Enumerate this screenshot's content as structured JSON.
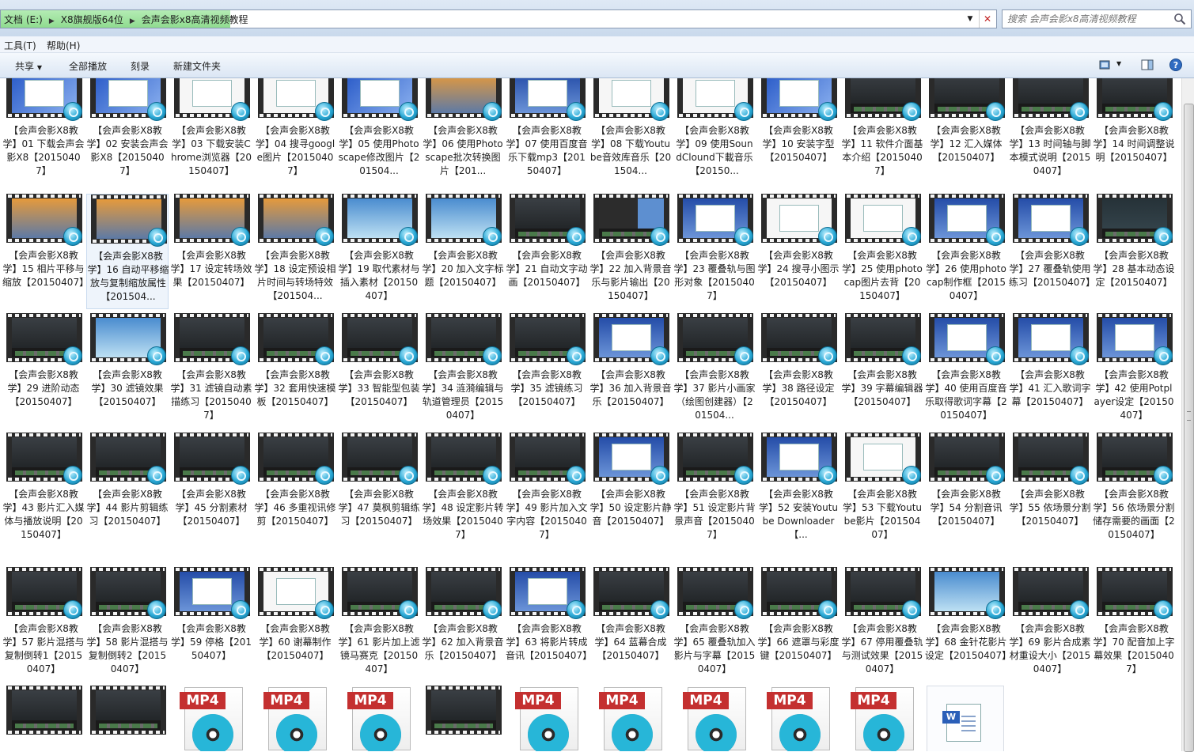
{
  "address": {
    "crumbs": [
      "文档 (E:)",
      "X8旗舰版64位",
      "会声会影x8高清视频教程"
    ],
    "search_placeholder": "搜索 会声会影x8高清视频教程"
  },
  "menu": {
    "tools": "工具(T)",
    "help": "帮助(H)"
  },
  "toolbar": {
    "share": "共享",
    "play_all": "全部播放",
    "burn": "刻录",
    "new_folder": "新建文件夹"
  },
  "items": [
    {
      "name": "【会声会影X8教学】01 下载会声会影X8【20150407】",
      "thumb": "s-blue"
    },
    {
      "name": "【会声会影X8教学】02 安装会声会影X8【20150407】",
      "thumb": "s-blue"
    },
    {
      "name": "【会声会影X8教学】03 下载安装Chrome浏览器【20150407】",
      "thumb": "s-white"
    },
    {
      "name": "【会声会影X8教学】04 搜寻google图片【20150407】",
      "thumb": "s-white"
    },
    {
      "name": "【会声会影X8教学】05 使用Photoscape修改图片【201504...",
      "thumb": "s-blue"
    },
    {
      "name": "【会声会影X8教学】06 使用Photoscape批次转换图片【201...",
      "thumb": "s-sunset"
    },
    {
      "name": "【会声会影X8教学】07 使用百度音乐下载mp3【20150407】",
      "thumb": "s-win"
    },
    {
      "name": "【会声会影X8教学】08 下载Youtube音效库音乐【201504...",
      "thumb": "s-white"
    },
    {
      "name": "【会声会影X8教学】09 使用SoundClound下載音乐【20150...",
      "thumb": "s-white"
    },
    {
      "name": "【会声会影X8教学】10 安装字型【20150407】",
      "thumb": "s-blue"
    },
    {
      "name": "【会声会影X8教学】11 软件介面基本介绍【20150407】",
      "thumb": "s-dark"
    },
    {
      "name": "【会声会影X8教学】12 汇入媒体【20150407】",
      "thumb": "s-dark"
    },
    {
      "name": "【会声会影X8教学】13 时间轴与脚本模式说明【20150407】",
      "thumb": "s-dark"
    },
    {
      "name": "【会声会影X8教学】14 时间调整说明【20150407】",
      "thumb": "s-dark"
    },
    {
      "name": "【会声会影X8教学】15 相片平移与缩放【20150407】",
      "thumb": "s-sunset"
    },
    {
      "name": "【会声会影X8教学】16 自动平移缩放与复制缩放属性【201504...",
      "thumb": "s-sunset"
    },
    {
      "name": "【会声会影X8教学】17 设定转场效果【20150407】",
      "thumb": "s-sunset"
    },
    {
      "name": "【会声会影X8教学】18 设定预设相片时间与转场特效【201504...",
      "thumb": "s-sunset"
    },
    {
      "name": "【会声会影X8教学】19 取代素材与插入素材【20150407】",
      "thumb": "s-sky"
    },
    {
      "name": "【会声会影X8教学】20 加入文字标题【20150407】",
      "thumb": "s-sky"
    },
    {
      "name": "【会声会影X8教学】21 自动文字动画【20150407】",
      "thumb": "s-dark"
    },
    {
      "name": "【会声会影X8教学】22 加入背景音乐与影片输出【20150407】",
      "thumb": "s-mixed"
    },
    {
      "name": "【会声会影X8教学】23 覆叠轨与图形对象【20150407】",
      "thumb": "s-win"
    },
    {
      "name": "【会声会影X8教学】24 搜寻小图示【20150407】",
      "thumb": "s-white"
    },
    {
      "name": "【会声会影X8教学】25 使用photocap图片去背【20150407】",
      "thumb": "s-white"
    },
    {
      "name": "【会声会影X8教学】26 使用photocap制作框【20150407】",
      "thumb": "s-win"
    },
    {
      "name": "【会声会影X8教学】27 覆叠轨使用练习【20150407】",
      "thumb": "s-win"
    },
    {
      "name": "【会声会影X8教学】28 基本动态设定【20150407】",
      "thumb": "s-teal"
    },
    {
      "name": "【会声会影X8教学】29 进阶动态【20150407】",
      "thumb": "s-dark"
    },
    {
      "name": "【会声会影X8教学】30 滤镜效果【20150407】",
      "thumb": "s-sky"
    },
    {
      "name": "【会声会影X8教学】31 滤镜自动素描练习【20150407】",
      "thumb": "s-dark"
    },
    {
      "name": "【会声会影X8教学】32 套用快速模板【20150407】",
      "thumb": "s-dark"
    },
    {
      "name": "【会声会影X8教学】33 智能型包装【20150407】",
      "thumb": "s-dark"
    },
    {
      "name": "【会声会影X8教学】34 涟漪编辑与轨道管理员【20150407】",
      "thumb": "s-dark"
    },
    {
      "name": "【会声会影X8教学】35 滤镜练习【20150407】",
      "thumb": "s-dark"
    },
    {
      "name": "【会声会影X8教学】36 加入背景音乐【20150407】",
      "thumb": "s-win"
    },
    {
      "name": "【会声会影X8教学】37 影片小画家（绘图创建器）【201504...",
      "thumb": "s-dark"
    },
    {
      "name": "【会声会影X8教学】38 路径设定【20150407】",
      "thumb": "s-dark"
    },
    {
      "name": "【会声会影X8教学】39 字幕编辑器【20150407】",
      "thumb": "s-dark"
    },
    {
      "name": "【会声会影X8教学】40 使用百度音乐取得歌词字幕【20150407】",
      "thumb": "s-win"
    },
    {
      "name": "【会声会影X8教学】41 汇入歌词字幕【20150407】",
      "thumb": "s-win"
    },
    {
      "name": "【会声会影X8教学】42 使用Potplayer设定【20150407】",
      "thumb": "s-win"
    },
    {
      "name": "【会声会影X8教学】43 影片汇入媒体与播放说明【20150407】",
      "thumb": "s-dark"
    },
    {
      "name": "【会声会影X8教学】44 影片剪辑练习【20150407】",
      "thumb": "s-dark"
    },
    {
      "name": "【会声会影X8教学】45 分割素材【20150407】",
      "thumb": "s-dark"
    },
    {
      "name": "【会声会影X8教学】46 多重视讯修剪【20150407】",
      "thumb": "s-dark"
    },
    {
      "name": "【会声会影X8教学】47 莫枫剪辑练习【20150407】",
      "thumb": "s-dark"
    },
    {
      "name": "【会声会影X8教学】48 设定影片转场效果【20150407】",
      "thumb": "s-dark"
    },
    {
      "name": "【会声会影X8教学】49 影片加入文字内容【20150407】",
      "thumb": "s-dark"
    },
    {
      "name": "【会声会影X8教学】50 设定影片静音【20150407】",
      "thumb": "s-win"
    },
    {
      "name": "【会声会影X8教学】51 设定影片背景声音【20150407】",
      "thumb": "s-dark"
    },
    {
      "name": "【会声会影X8教学】52 安装Youtube Downloader【...",
      "thumb": "s-win"
    },
    {
      "name": "【会声会影X8教学】53 下载Youtube影片【20150407】",
      "thumb": "s-white"
    },
    {
      "name": "【会声会影X8教学】54 分割音讯【20150407】",
      "thumb": "s-dark"
    },
    {
      "name": "【会声会影X8教学】55 依场景分割【20150407】",
      "thumb": "s-dark"
    },
    {
      "name": "【会声会影X8教学】56 依场景分割储存需要的画面【20150407】",
      "thumb": "s-dark"
    },
    {
      "name": "【会声会影X8教学】57 影片混搭与复制倒转1【20150407】",
      "thumb": "s-dark"
    },
    {
      "name": "【会声会影X8教学】58 影片混搭与复制倒转2【20150407】",
      "thumb": "s-dark"
    },
    {
      "name": "【会声会影X8教学】59 停格【20150407】",
      "thumb": "s-win"
    },
    {
      "name": "【会声会影X8教学】60 谢幕制作【20150407】",
      "thumb": "s-white"
    },
    {
      "name": "【会声会影X8教学】61 影片加上滤镜马赛克【20150407】",
      "thumb": "s-dark"
    },
    {
      "name": "【会声会影X8教学】62 加入背景音乐【20150407】",
      "thumb": "s-dark"
    },
    {
      "name": "【会声会影X8教学】63 将影片转成音讯【20150407】",
      "thumb": "s-win"
    },
    {
      "name": "【会声会影X8教学】64 蓝幕合成【20150407】",
      "thumb": "s-dark"
    },
    {
      "name": "【会声会影X8教学】65 覆叠轨加入影片与字幕【20150407】",
      "thumb": "s-dark"
    },
    {
      "name": "【会声会影X8教学】66 遮罩与彩度键【20150407】",
      "thumb": "s-dark"
    },
    {
      "name": "【会声会影X8教学】67 停用覆叠轨与测试效果【20150407】",
      "thumb": "s-dark"
    },
    {
      "name": "【会声会影X8教学】68 金针花影片设定【20150407】",
      "thumb": "s-sky"
    },
    {
      "name": "【会声会影X8教学】69 影片合成素材重设大小【20150407】",
      "thumb": "s-dark"
    },
    {
      "name": "【会声会影X8教学】70 配音加上字幕效果【20150407】",
      "thumb": "s-dark"
    }
  ],
  "last_row": [
    "video",
    "video",
    "mp4",
    "mp4",
    "mp4",
    "video",
    "mp4",
    "mp4",
    "mp4",
    "mp4",
    "mp4",
    "doc"
  ],
  "mp4_label": "MP4",
  "doc_glyph": "W"
}
